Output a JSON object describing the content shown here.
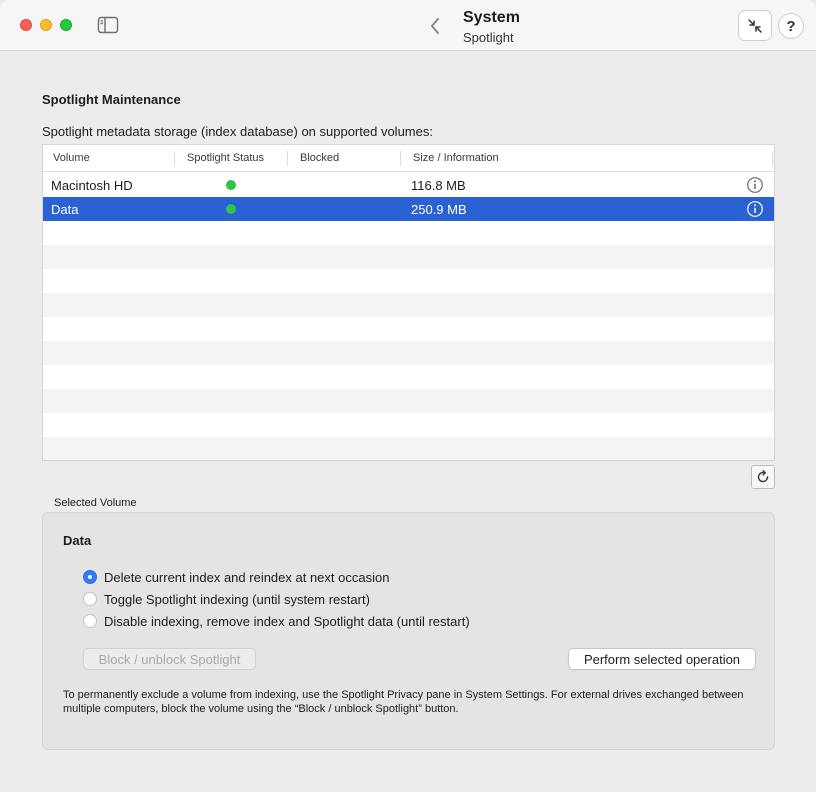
{
  "window": {
    "title": "System",
    "subtitle": "Spotlight"
  },
  "toolbar": {
    "help_label": "?",
    "icons": [
      "sidebar-icon",
      "chevron-left-icon",
      "shrink-icon",
      "help-icon"
    ]
  },
  "section": {
    "title": "Spotlight Maintenance",
    "caption": "Spotlight metadata storage (index database) on supported volumes:"
  },
  "table": {
    "columns": [
      "Volume",
      "Spotlight Status",
      "Blocked",
      "Size / Information"
    ],
    "rows": [
      {
        "volume": "Macintosh HD",
        "status": "green",
        "blocked": "",
        "size": "116.8 MB",
        "selected": false
      },
      {
        "volume": "Data",
        "status": "green",
        "blocked": "",
        "size": "250.9 MB",
        "selected": true
      }
    ],
    "status_color": "#2fc34a",
    "selection_color": "#2a62d3"
  },
  "selected_volume": {
    "group_label": "Selected Volume",
    "name": "Data",
    "options": [
      {
        "label": "Delete current index and reindex at next occasion",
        "selected": true
      },
      {
        "label": "Toggle Spotlight indexing (until system restart)",
        "selected": false
      },
      {
        "label": "Disable indexing, remove index and Spotlight data (until restart)",
        "selected": false
      }
    ],
    "block_button": "Block / unblock Spotlight",
    "perform_button": "Perform selected operation",
    "note": "To permanently exclude a volume from indexing, use the Spotlight Privacy pane in System Settings. For external drives exchanged between multiple computers, block the volume using the “Block / unblock Spotlight” button."
  },
  "colors": {
    "accent": "#2f7bf6",
    "close": "#ff5f57",
    "minimize": "#febc2e",
    "maximize": "#28c840"
  }
}
